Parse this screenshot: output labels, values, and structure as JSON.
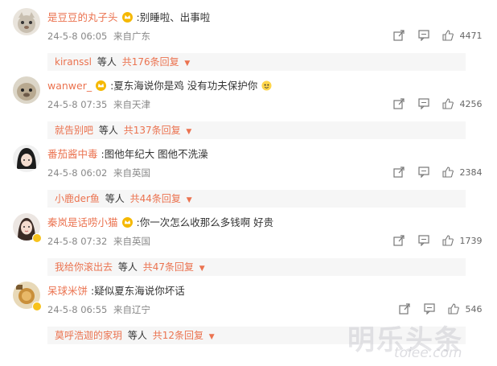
{
  "comments": [
    {
      "username": "是豆豆的丸子头",
      "text": ":别睡啦、出事啦",
      "date": "24-5-8 06:05",
      "location": "来自广东",
      "likes": "4471",
      "reply_user": "kiranssl",
      "reply_mid": "等人",
      "reply_count": "共176条回复",
      "avatar": "cat-face",
      "verified": false
    },
    {
      "username": "wanwer_",
      "text": ":夏东海说你是鸡 没有功夫保护你",
      "date": "24-5-8 07:35",
      "location": "来自天津",
      "likes": "4256",
      "reply_user": "就告别吧",
      "reply_mid": "等人",
      "reply_count": "共137条回复",
      "avatar": "otter-face",
      "verified": false
    },
    {
      "username": "番茄酱中毒",
      "text": ":图他年纪大 图他不洗澡",
      "date": "24-5-8 06:02",
      "location": "来自英国",
      "likes": "2384",
      "reply_user": "小鹿der鱼",
      "reply_mid": "等人",
      "reply_count": "共44条回复",
      "avatar": "anime-dark",
      "verified": false
    },
    {
      "username": "秦岚是话唠小猫",
      "text": ":你一次怎么收那么多钱啊 好贵",
      "date": "24-5-8 07:32",
      "location": "来自英国",
      "likes": "1739",
      "reply_user": "我给你滚出去",
      "reply_mid": "等人",
      "reply_count": "共47条回复",
      "avatar": "girl-portrait",
      "verified": true
    },
    {
      "username": "呆球米饼",
      "text": ":疑似夏东海说你坏话",
      "date": "24-5-8 06:55",
      "location": "来自辽宁",
      "likes": "546",
      "reply_user": "莫呼浩迦的家玥",
      "reply_mid": "等人",
      "reply_count": "共12条回复",
      "avatar": "food-photo",
      "verified": true
    }
  ],
  "icons": {
    "share": "share-icon",
    "comment": "comment-icon",
    "like": "thumbs-up-icon",
    "crown": "crown-icon",
    "caret": "▼"
  },
  "colors": {
    "username": "#eb7350",
    "text": "#333333",
    "meta": "#888888",
    "reply_bg": "#f6f6f6"
  },
  "watermark": {
    "main": "明乐头条",
    "sub": "toiee.com"
  }
}
